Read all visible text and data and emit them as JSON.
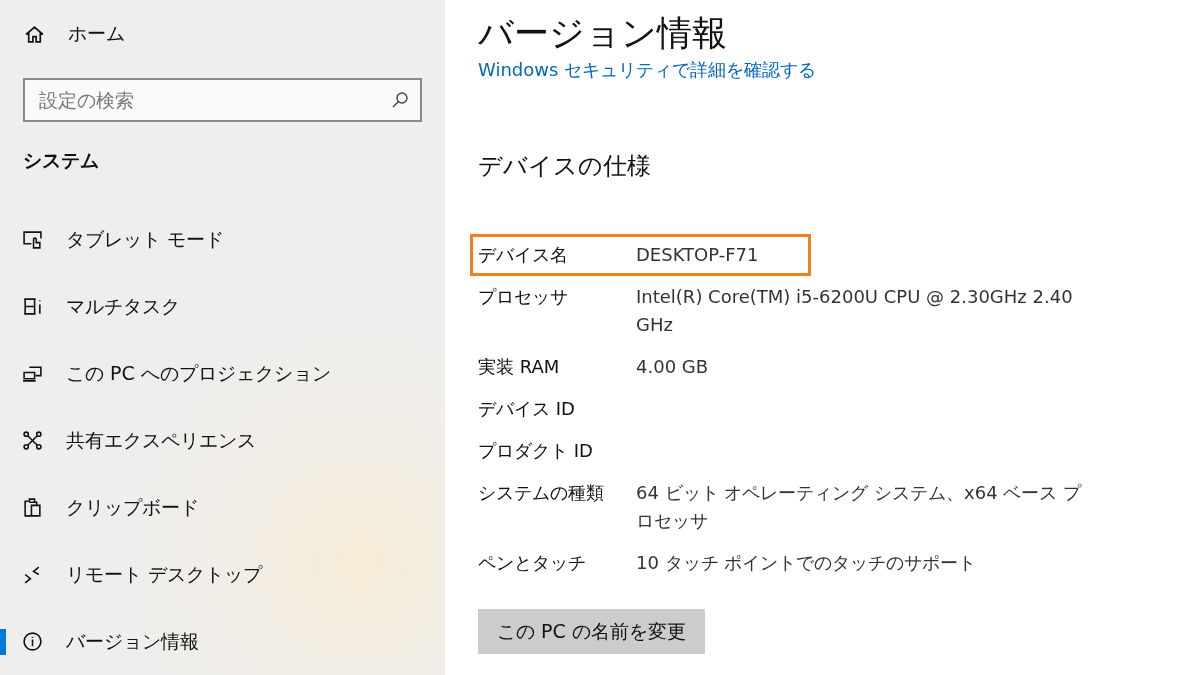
{
  "sidebar": {
    "home": "ホーム",
    "search": {
      "placeholder": "設定の検索"
    },
    "section": "システム",
    "items": [
      {
        "label": "タブレット モード",
        "kind": "tablet",
        "selected": false
      },
      {
        "label": "マルチタスク",
        "kind": "multitask",
        "selected": false
      },
      {
        "label": "この PC へのプロジェクション",
        "kind": "project",
        "selected": false
      },
      {
        "label": "共有エクスペリエンス",
        "kind": "share",
        "selected": false
      },
      {
        "label": "クリップボード",
        "kind": "clipboard",
        "selected": false
      },
      {
        "label": "リモート デスクトップ",
        "kind": "remote",
        "selected": false
      },
      {
        "label": "バージョン情報",
        "kind": "info",
        "selected": true
      }
    ]
  },
  "main": {
    "title": "バージョン情報",
    "link": "Windows セキュリティで詳細を確認する",
    "section": "デバイスの仕様",
    "specs": [
      {
        "label": "デバイス名",
        "value": "DESKTOP-F71",
        "highlighted": true
      },
      {
        "label": "プロセッサ",
        "value": "Intel(R) Core(TM) i5-6200U CPU @ 2.30GHz   2.40 GHz",
        "highlighted": false
      },
      {
        "label": "実装 RAM",
        "value": "4.00 GB",
        "highlighted": false
      },
      {
        "label": "デバイス ID",
        "highlighted": false
      },
      {
        "label": "プロダクト ID",
        "highlighted": false
      },
      {
        "label": "システムの種類",
        "value": "64 ビット オペレーティング システム、x64 ベース プロセッサ",
        "highlighted": false
      },
      {
        "label": "ペンとタッチ",
        "value": "10 タッチ ポイントでのタッチのサポート",
        "highlighted": false
      }
    ],
    "button": "この PC の名前を変更"
  }
}
